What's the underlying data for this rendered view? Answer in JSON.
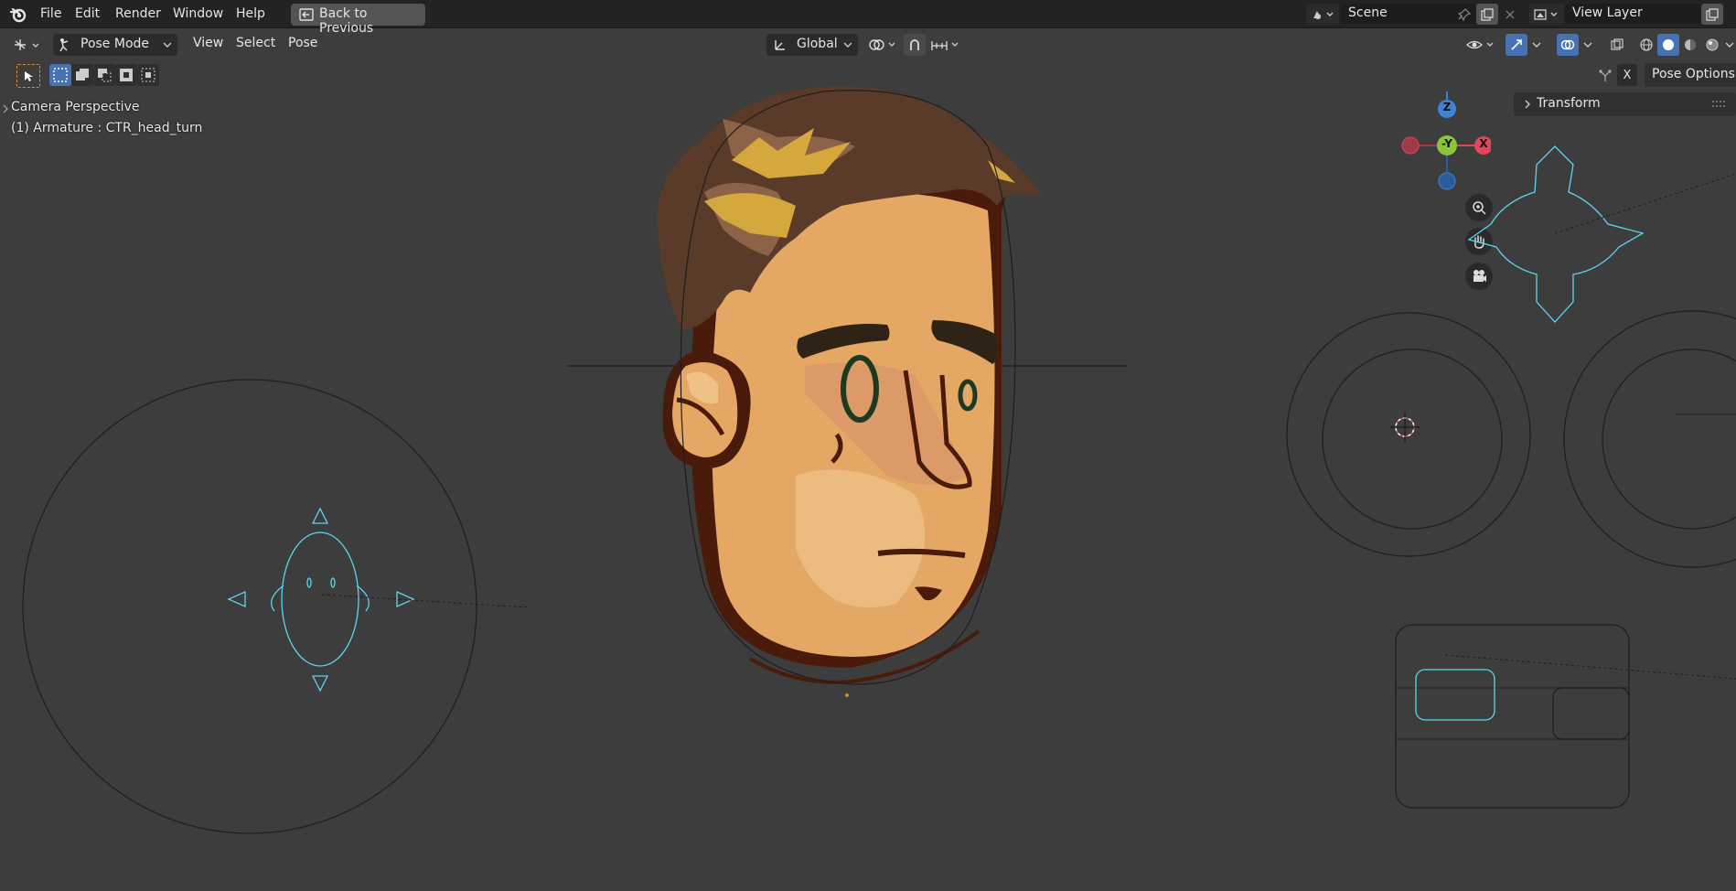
{
  "menu": {
    "file": "File",
    "edit": "Edit",
    "render": "Render",
    "window": "Window",
    "help": "Help",
    "back_to_previous": "Back to Previous"
  },
  "scene": {
    "name": "Scene"
  },
  "view_layer": {
    "name": "View Layer"
  },
  "header": {
    "mode": "Pose Mode",
    "view": "View",
    "select": "Select",
    "pose": "Pose",
    "orientation": "Global"
  },
  "sidebar": {
    "pose_options": "Pose Options",
    "x_label": "X",
    "transform": "Transform"
  },
  "viewport": {
    "camera_text": "Camera Perspective",
    "object_text": "(1) Armature : CTR_head_turn",
    "axis_z": "Z",
    "axis_y": "-Y",
    "axis_x": "X"
  },
  "colors": {
    "bg_viewport": "#3d3d3d",
    "topbar": "#232323",
    "accent_blue": "#4772b3",
    "bone_cyan": "#5cd6f0",
    "skin": "#e4a764",
    "hair": "#5a3a28",
    "outline": "#4a1a0a"
  }
}
